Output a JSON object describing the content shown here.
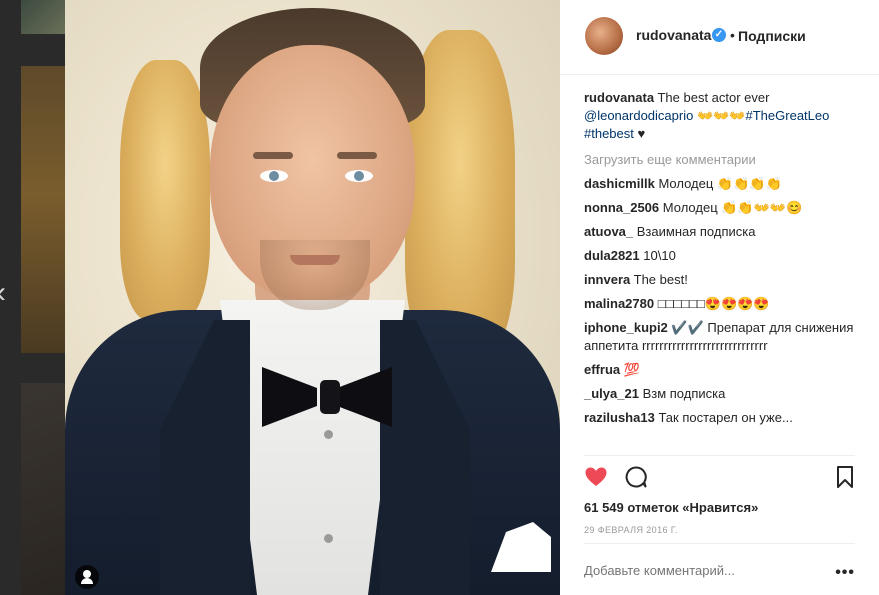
{
  "post": {
    "username": "rudovanata",
    "follow_separator": "•",
    "follow_label": "Подписки",
    "caption": {
      "username": "rudovanata",
      "text": "The best actor ever",
      "mention": "@leonardodicaprio",
      "emoji": "👐👐👐",
      "hashtag1": "#TheGreatLeo",
      "hashtag2": "#thebest",
      "heart": "♥"
    },
    "load_more": "Загрузить еще комментарии",
    "comments": [
      {
        "user": "dashicmillk",
        "text": "Молодец 👏👏👏👏"
      },
      {
        "user": "nonna_2506",
        "text": "Молодец 👏👏👐👐😊"
      },
      {
        "user": "atuova_",
        "text": "Взаимная подписка"
      },
      {
        "user": "dula2821",
        "text": "10\\10"
      },
      {
        "user": "innvera",
        "text": "The best!"
      },
      {
        "user": "malina2780",
        "text": "□□□□□□😍😍😍😍"
      },
      {
        "user": "iphone_kupi2",
        "text": "✔️✔️ Препарат для снижения аппетита rrrrrrrrrrrrrrrrrrrrrrrrrrrrr"
      },
      {
        "user": "effrua",
        "text": "💯"
      },
      {
        "user": "_ulya_21",
        "text": "Взм подписка"
      },
      {
        "user": "razilusha13",
        "text": "Так постарел он уже..."
      }
    ],
    "likes": "61 549 отметок «Нравится»",
    "date": "29 ФЕВРАЛЯ 2016 Г.",
    "add_comment_placeholder": "Добавьте комментарий...",
    "more": "•••"
  },
  "icons": {
    "heart": "heart-icon",
    "comment": "comment-icon",
    "save": "bookmark-icon",
    "prev": "chevron-left-icon",
    "user_tag": "user-tag-icon",
    "verified": "verified-badge-icon"
  },
  "colors": {
    "like": "#ed4956",
    "link": "#003569",
    "verified": "#3897f0",
    "muted": "#999999",
    "text": "#262626"
  },
  "nav": {
    "prev_glyph": "‹"
  },
  "verified_glyph": "✓"
}
